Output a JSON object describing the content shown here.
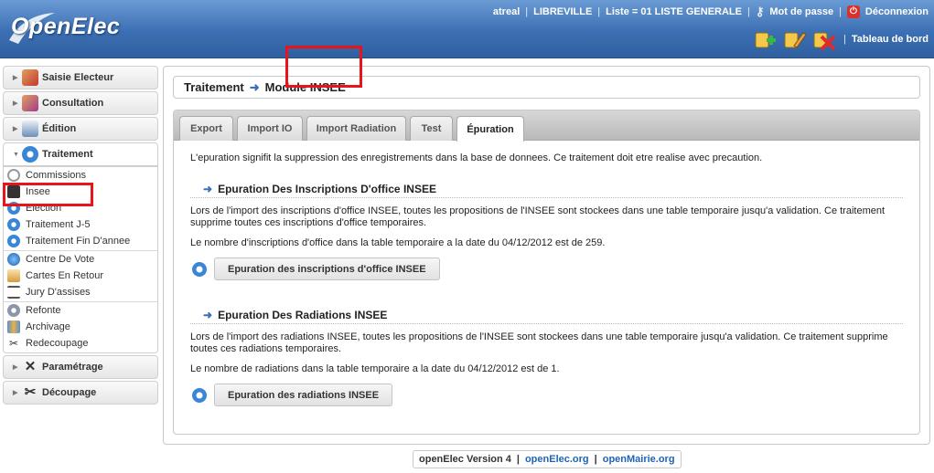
{
  "header": {
    "app_name": "OpenElec",
    "user": "atreal",
    "city": "LIBREVILLE",
    "list": "Liste = 01 LISTE GENERALE",
    "password_link": "Mot de passe",
    "logout_link": "Déconnexion",
    "dashboard_link": "Tableau de bord"
  },
  "sidebar": {
    "menus": [
      {
        "label": "Saisie Electeur"
      },
      {
        "label": "Consultation"
      },
      {
        "label": "Édition"
      },
      {
        "label": "Traitement"
      },
      {
        "label": "Paramétrage"
      },
      {
        "label": "Découpage"
      }
    ],
    "traitement_items": [
      {
        "label": "Commissions"
      },
      {
        "label": "Insee"
      },
      {
        "label": "Election"
      },
      {
        "label": "Traitement J-5"
      },
      {
        "label": "Traitement Fin D'annee"
      },
      {
        "label": "Centre De Vote"
      },
      {
        "label": "Cartes En Retour"
      },
      {
        "label": "Jury D'assises"
      },
      {
        "label": "Refonte"
      },
      {
        "label": "Archivage"
      },
      {
        "label": "Redecoupage"
      }
    ]
  },
  "breadcrumb": {
    "level1": "Traitement",
    "level2": "Module INSEE"
  },
  "tabs": [
    {
      "label": "Export"
    },
    {
      "label": "Import IO"
    },
    {
      "label": "Import Radiation"
    },
    {
      "label": "Test"
    },
    {
      "label": "Épuration"
    }
  ],
  "content": {
    "intro": "L'epuration signifit la suppression des enregistrements dans la base de donnees. Ce traitement doit etre realise avec precaution.",
    "section1": {
      "title": "Epuration Des Inscriptions D'office INSEE",
      "para1": "Lors de l'import des inscriptions d'office INSEE, toutes les propositions de l'INSEE sont stockees dans une table temporaire jusqu'a validation. Ce traitement supprime toutes ces inscriptions d'office temporaires.",
      "para2": "Le nombre d'inscriptions d'office dans la table temporaire a la date du 04/12/2012 est de 259.",
      "button": "Epuration des inscriptions d'office INSEE"
    },
    "section2": {
      "title": "Epuration Des Radiations INSEE",
      "para1": "Lors de l'import des radiations INSEE, toutes les propositions de l'INSEE sont stockees dans une table temporaire jusqu'a validation. Ce traitement supprime toutes ces radiations temporaires.",
      "para2": "Le nombre de radiations dans la table temporaire a la date du 04/12/2012 est de 1.",
      "button": "Epuration des radiations INSEE"
    }
  },
  "footer": {
    "version": "openElec Version 4",
    "link1": "openElec.org",
    "link2": "openMairie.org"
  },
  "colors": {
    "header_blue": "#3c6fb3",
    "highlight_red": "#e8141b",
    "link_blue": "#1f64b4"
  }
}
